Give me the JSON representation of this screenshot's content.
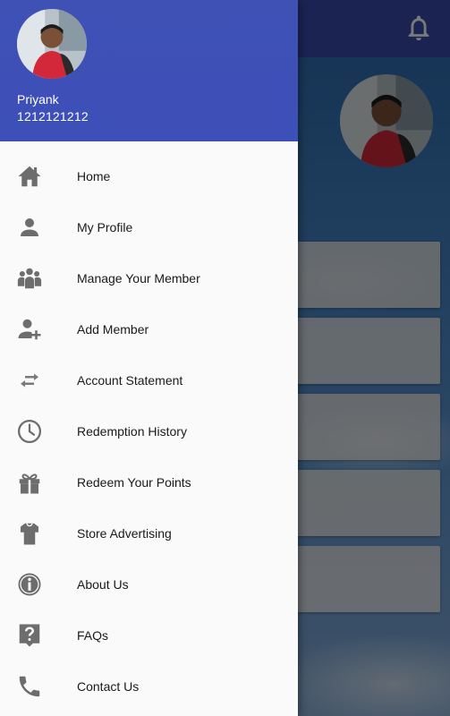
{
  "app": {
    "icons": {
      "notification": "bell-icon"
    }
  },
  "drawer": {
    "user": {
      "name": "Priyank",
      "phone": "1212121212",
      "avatar": "profile-photo"
    },
    "items": [
      {
        "label": "Home",
        "icon": "home-icon"
      },
      {
        "label": "My Profile",
        "icon": "person-icon"
      },
      {
        "label": "Manage Your Member",
        "icon": "group-icon"
      },
      {
        "label": "Add Member",
        "icon": "add-person-icon"
      },
      {
        "label": "Account Statement",
        "icon": "swap-arrows-icon"
      },
      {
        "label": "Redemption History",
        "icon": "clock-icon"
      },
      {
        "label": "Redeem Your Points",
        "icon": "gift-icon"
      },
      {
        "label": "Store Advertising",
        "icon": "shirt-icon"
      },
      {
        "label": "About Us",
        "icon": "info-icon"
      },
      {
        "label": "FAQs",
        "icon": "help-icon"
      },
      {
        "label": "Contact Us",
        "icon": "phone-icon"
      }
    ]
  }
}
